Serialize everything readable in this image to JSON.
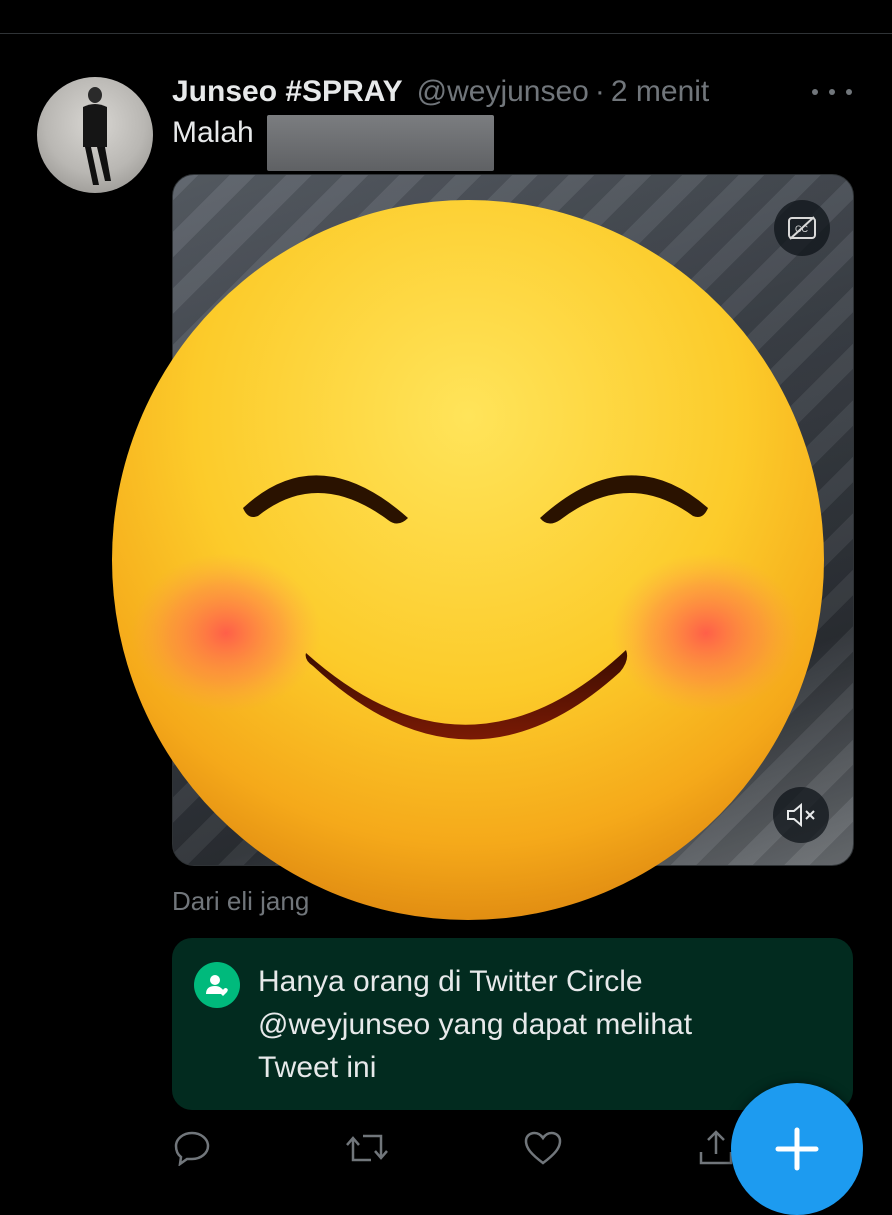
{
  "tweet": {
    "author_name": "Junseo #SPRAY",
    "handle": "@weyjunseo",
    "separator": "·",
    "time": "2 menit",
    "text": "Malah",
    "attribution": "Dari eli jang"
  },
  "circle_notice": {
    "line1": "Hanya orang di Twitter Circle",
    "line2": "@weyjunseo yang dapat melihat",
    "line3": "Tweet ini"
  },
  "icons": {
    "more": "more-options-icon",
    "captions": "closed-captions-icon",
    "mute": "speaker-muted-icon",
    "reply": "reply-icon",
    "retweet": "retweet-icon",
    "like": "heart-icon",
    "share": "share-icon",
    "compose": "plus-icon",
    "circle": "twitter-circle-icon",
    "overlay": "smiling-blush-emoji"
  },
  "colors": {
    "background": "#000000",
    "accent": "#1d9bf0",
    "circle_green": "#00ba7c",
    "circle_bg": "#022b1f",
    "muted_text": "#71767b"
  }
}
